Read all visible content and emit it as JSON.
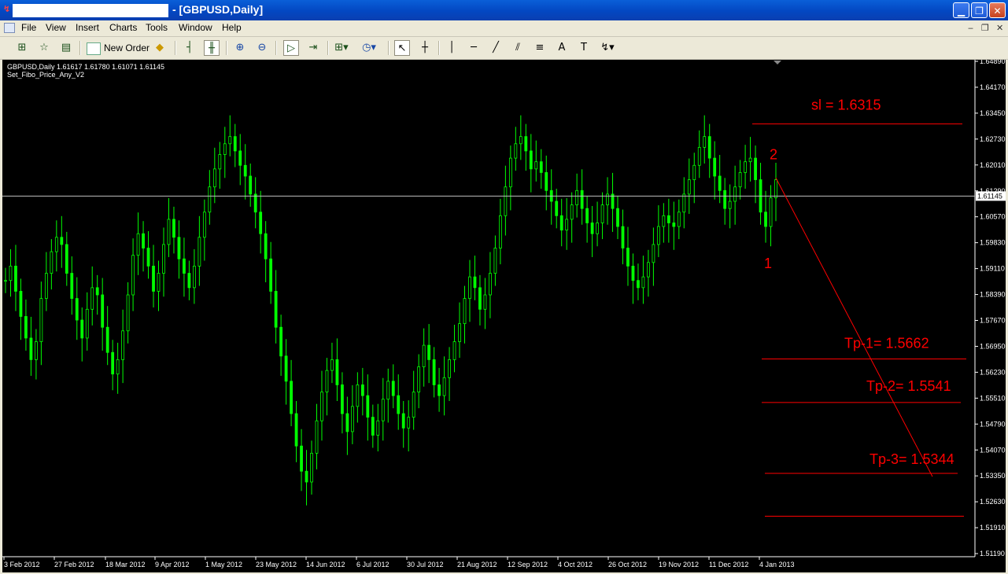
{
  "window": {
    "title": "- [GBPUSD,Daily]"
  },
  "menu": [
    "File",
    "View",
    "Insert",
    "Charts",
    "Tools",
    "Window",
    "Help"
  ],
  "toolbar": {
    "new_order_label": "New Order",
    "badge": "4"
  },
  "chart_header": {
    "symbol_line": "GBPUSD,Daily  1.61617 1.61780 1.61071 1.61145",
    "indicator": "Set_Fibo_Price_Any_V2"
  },
  "colors": {
    "candle": "#00FF00",
    "annotation": "#FF0000",
    "background": "#000000",
    "text": "#FFFFFF"
  },
  "chart_data": {
    "type": "candlestick",
    "y_ticks": [
      "1.64890",
      "1.64170",
      "1.63450",
      "1.62730",
      "1.62010",
      "1.61290",
      "1.60570",
      "1.59830",
      "1.59110",
      "1.58390",
      "1.57670",
      "1.56950",
      "1.56230",
      "1.55510",
      "1.54790",
      "1.54070",
      "1.53350",
      "1.52630",
      "1.51910",
      "1.51190"
    ],
    "x_ticks": [
      "3 Feb 2012",
      "27 Feb 2012",
      "18 Mar 2012",
      "9 Apr 2012",
      "1 May 2012",
      "23 May 2012",
      "14 Jun 2012",
      "6 Jul 2012",
      "30 Jul 2012",
      "21 Aug 2012",
      "12 Sep 2012",
      "4 Oct 2012",
      "26 Oct 2012",
      "19 Nov 2012",
      "11 Dec 2012",
      "4 Jan 2013"
    ],
    "ylim": [
      1.5119,
      1.6489
    ],
    "current_price": "1.61145",
    "close_series": [
      1.588,
      1.592,
      1.585,
      1.578,
      1.572,
      1.566,
      1.571,
      1.583,
      1.59,
      1.596,
      1.6,
      1.598,
      1.59,
      1.583,
      1.577,
      1.572,
      1.58,
      1.586,
      1.584,
      1.575,
      1.568,
      1.562,
      1.566,
      1.574,
      1.584,
      1.595,
      1.601,
      1.597,
      1.592,
      1.585,
      1.59,
      1.598,
      1.605,
      1.6,
      1.594,
      1.59,
      1.586,
      1.592,
      1.6,
      1.607,
      1.614,
      1.619,
      1.623,
      1.626,
      1.628,
      1.624,
      1.62,
      1.617,
      1.612,
      1.607,
      1.601,
      1.594,
      1.585,
      1.575,
      1.567,
      1.56,
      1.551,
      1.542,
      1.535,
      1.532,
      1.54,
      1.549,
      1.557,
      1.563,
      1.566,
      1.559,
      1.551,
      1.546,
      1.553,
      1.559,
      1.556,
      1.55,
      1.545,
      1.549,
      1.555,
      1.56,
      1.556,
      1.551,
      1.547,
      1.55,
      1.557,
      1.564,
      1.57,
      1.566,
      1.559,
      1.556,
      1.561,
      1.566,
      1.571,
      1.576,
      1.583,
      1.589,
      1.586,
      1.58,
      1.584,
      1.59,
      1.597,
      1.606,
      1.614,
      1.622,
      1.626,
      1.628,
      1.624,
      1.619,
      1.621,
      1.618,
      1.613,
      1.61,
      1.606,
      1.602,
      1.605,
      1.609,
      1.613,
      1.608,
      1.604,
      1.601,
      1.604,
      1.609,
      1.612,
      1.608,
      1.603,
      1.597,
      1.592,
      1.588,
      1.586,
      1.589,
      1.593,
      1.598,
      1.603,
      1.606,
      1.604,
      1.603,
      1.607,
      1.612,
      1.616,
      1.62,
      1.625,
      1.628,
      1.622,
      1.617,
      1.613,
      1.608,
      1.61,
      1.614,
      1.618,
      1.621,
      1.622,
      1.616,
      1.607,
      1.603,
      1.611,
      1.616
    ],
    "fib_levels": [
      {
        "label": "sl = 1.6315",
        "value": 1.6315
      },
      {
        "label": "Tp-1= 1.5662",
        "value": 1.5662
      },
      {
        "label": "Tp-2= 1.5541",
        "value": 1.5541
      },
      {
        "label": "Tp-3= 1.5344",
        "value": 1.5344
      },
      {
        "label": "",
        "value": 1.5225
      }
    ],
    "point_labels": [
      "1",
      "2"
    ]
  }
}
